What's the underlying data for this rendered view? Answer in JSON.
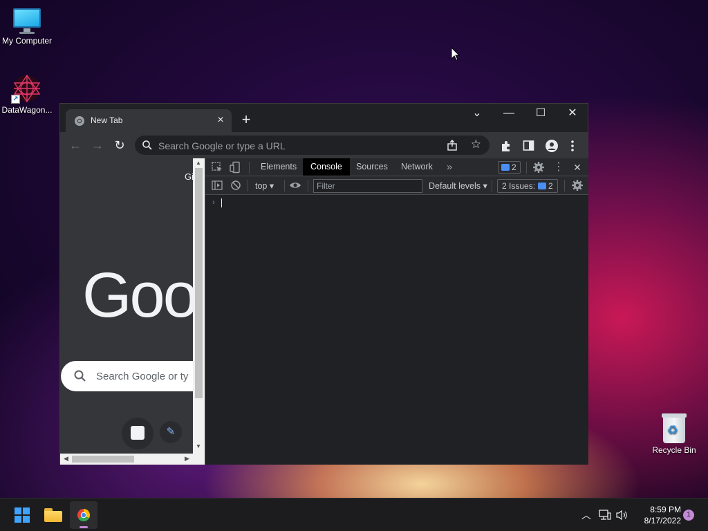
{
  "desktop": {
    "icons": [
      {
        "label": "My Computer"
      },
      {
        "label": "DataWagon..."
      },
      {
        "label": "Recycle Bin"
      }
    ]
  },
  "browser": {
    "tab": {
      "title": "New Tab",
      "close": "×"
    },
    "new_tab": "+",
    "controls": {
      "tab_search": "⌄",
      "minimize": "—",
      "maximize": "☐",
      "close": "✕"
    },
    "toolbar": {
      "back": "←",
      "forward": "→",
      "reload": "↻",
      "omnibox_placeholder": "Search Google or type a URL",
      "bookmark": "☆"
    },
    "ntp": {
      "top_link": "Gi",
      "logo": "Goo",
      "search_placeholder": "Search Google or ty",
      "customize": "✎"
    }
  },
  "devtools": {
    "tabs": [
      {
        "label": "Elements"
      },
      {
        "label": "Console"
      },
      {
        "label": "Sources"
      },
      {
        "label": "Network"
      }
    ],
    "more_tabs": "»",
    "messages_badge": "2",
    "close": "✕",
    "more": "⋮",
    "context": "top ▾",
    "filter_placeholder": "Filter",
    "levels": "Default levels ▾",
    "issues_label": "2 Issues:",
    "issues_count": "2",
    "prompt": "›"
  },
  "taskbar": {
    "tray_chevron": "︿",
    "time": "8:59 PM",
    "date": "8/17/2022",
    "notification_count": "1"
  },
  "colors": {
    "accent": "#4b8ef1",
    "window_bg": "#202124",
    "toolbar_bg": "#35363a",
    "taskbar_bg": "#1c1c1e",
    "active_indicator": "#c48ad7"
  }
}
